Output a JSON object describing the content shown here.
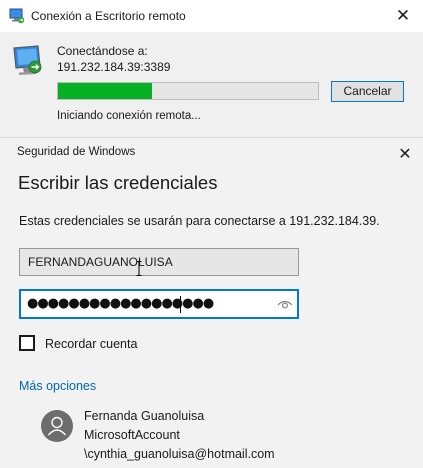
{
  "rdp_window": {
    "title": "Conexión a Escritorio remoto",
    "close_glyph": "✕",
    "connecting_label": "Conectándose a:",
    "address": "191.232.184.39:3389",
    "progress": 0.36,
    "cancel_label": "Cancelar",
    "status": "Iniciando conexión remota...",
    "progress_color": "#06b025"
  },
  "security_dialog": {
    "header": "Seguridad de Windows",
    "close_glyph": "✕",
    "title": "Escribir las credenciales",
    "description": "Estas credenciales se usarán para conectarse a 191.232.184.39.",
    "username_value": "FERNANDAGUANOLUISA",
    "password_dots": "●●●●●●●●●●●●●●●●●●",
    "remember_label": "Recordar cuenta",
    "remember_checked": false,
    "more_options": "Más opciones",
    "account": {
      "name": "Fernanda Guanoluisa",
      "type": "MicrosoftAccount",
      "email": "\\cynthia_guanoluisa@hotmail.com"
    },
    "accent_color": "#0078d7",
    "link_color": "#0066b4"
  },
  "icons": [
    "remote-desktop-icon",
    "monitor-icon",
    "close-icon",
    "password-reveal-icon",
    "user-avatar-icon",
    "mouse-cursor-icon"
  ]
}
